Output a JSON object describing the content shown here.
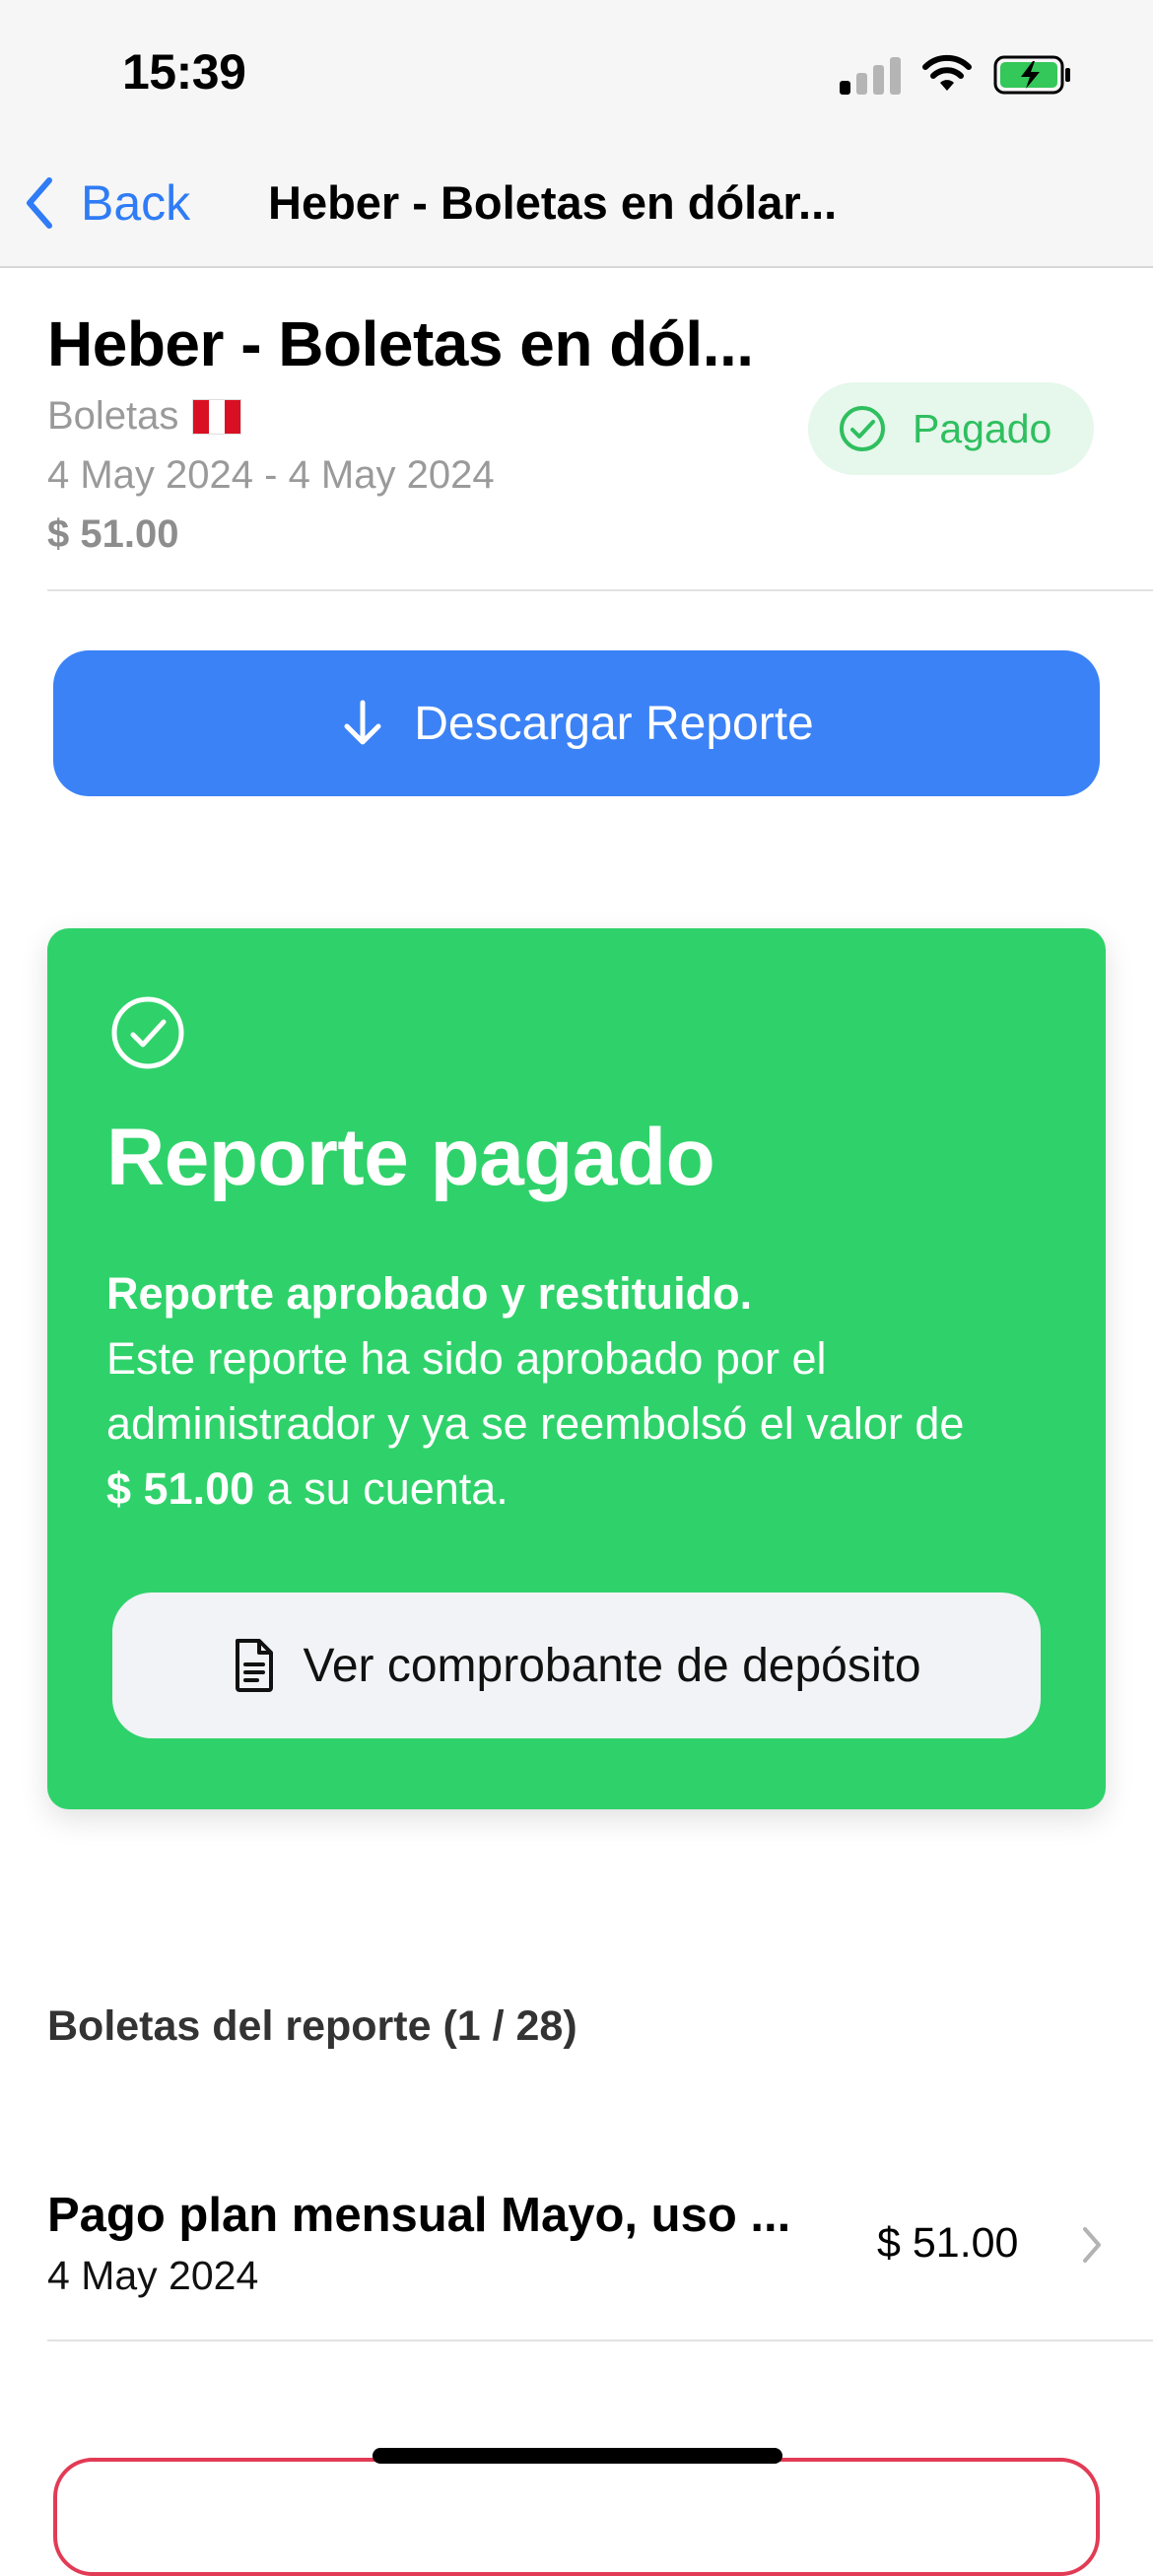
{
  "status_bar": {
    "time": "15:39"
  },
  "nav": {
    "back_label": "Back",
    "title": "Heber - Boletas en dólar..."
  },
  "report": {
    "title": "Heber - Boletas en dól...",
    "category": "Boletas",
    "dates": "4 May 2024 - 4 May 2024",
    "amount": "$ 51.00",
    "status": "Pagado",
    "status_color": "#2fbf5f"
  },
  "download_button": {
    "label": "Descargar Reporte",
    "icon": "arrow-down-icon",
    "color": "#3b82f6"
  },
  "paid_card": {
    "title": "Reporte pagado",
    "subtitle": "Reporte aprobado y restituido.",
    "text_before": "Este reporte ha sido aprobado por el administrador y ya se reembolsó el valor de",
    "amount": "$ 51.00",
    "text_after": " a su cuenta.",
    "proof_button_label": "Ver comprobante de depósito",
    "color": "#2fd26a"
  },
  "receipts": {
    "section_title": "Boletas del reporte (1 / 28)",
    "items": [
      {
        "title": "Pago plan mensual Mayo, uso ...",
        "date": "4 May 2024",
        "amount": "$ 51.00"
      }
    ]
  }
}
